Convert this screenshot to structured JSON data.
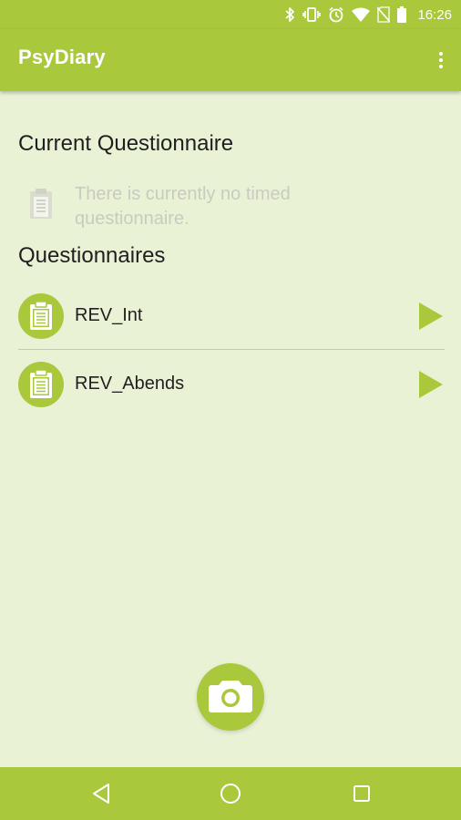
{
  "status_bar": {
    "time": "16:26",
    "icons": [
      "bluetooth-icon",
      "vibrate-icon",
      "alarm-icon",
      "wifi-icon",
      "no-sim-icon",
      "battery-icon"
    ]
  },
  "app_bar": {
    "title": "PsyDiary",
    "menu_icon": "overflow-menu-icon"
  },
  "current": {
    "heading": "Current Questionnaire",
    "empty_message": "There is currently no timed questionnaire."
  },
  "questionnaires": {
    "heading": "Questionnaires",
    "items": [
      {
        "label": "REV_Int",
        "icon": "clipboard-icon",
        "action_icon": "play-icon"
      },
      {
        "label": "REV_Abends",
        "icon": "clipboard-icon",
        "action_icon": "play-icon"
      }
    ]
  },
  "fab": {
    "icon": "camera-icon"
  },
  "nav_bar": {
    "icons": [
      "back-icon",
      "home-icon",
      "recents-icon"
    ]
  },
  "colors": {
    "primary": "#a9c83c",
    "background": "#eaf2d6",
    "text": "#1f1f1f",
    "disabled_text": "#c8ccc0"
  }
}
